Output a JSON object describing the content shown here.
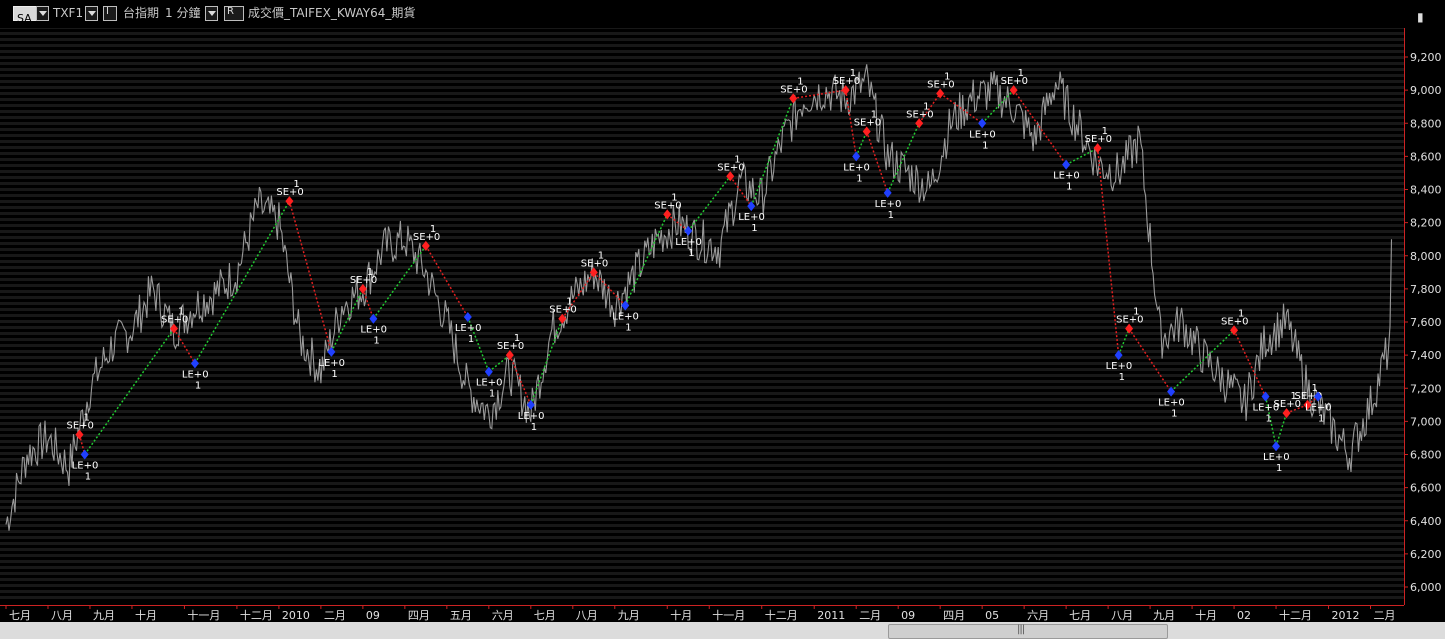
{
  "toolbar": {
    "symbol_button": "SA",
    "symbol": "TXF1",
    "mode_button": "I",
    "exchange_name": "台指期",
    "interval": "1 分鐘",
    "chart_type_button": "R",
    "series_desc": "成交價_TAIFEX_KWAY64_期貨",
    "settings_icon": "settings-icon"
  },
  "colors": {
    "background": "#000000",
    "price": "#9a9a9a",
    "trend_line": "#22c832",
    "sell_marker": "#ff2020",
    "buy_marker": "#2040ff",
    "axis_border": "#cc2222"
  },
  "chart_data": {
    "type": "line",
    "ylim": [
      5900,
      9300
    ],
    "y_ticks": [
      "9,200",
      "9,000",
      "8,800",
      "8,600",
      "8,400",
      "8,200",
      "8,000",
      "7,800",
      "7,600",
      "7,400",
      "7,200",
      "7,000",
      "6,800",
      "6,600",
      "6,400",
      "6,200",
      "6,000"
    ],
    "x_ticks": [
      "七月",
      "八月",
      "九月",
      "十月",
      "十一月",
      "十二月",
      "2010",
      "二月",
      "09",
      "四月",
      "五月",
      "六月",
      "七月",
      "八月",
      "九月",
      "十月",
      "十一月",
      "十二月",
      "2011",
      "二月",
      "09",
      "四月",
      "05",
      "六月",
      "七月",
      "八月",
      "九月",
      "十月",
      "02",
      "十二月",
      "2012",
      "二月"
    ],
    "x_tick_index": [
      0,
      4,
      8,
      12,
      17,
      22,
      26,
      30,
      34,
      38,
      42,
      46,
      50,
      54,
      58,
      63,
      67,
      72,
      77,
      81,
      85,
      89,
      93,
      97,
      101,
      105,
      109,
      113,
      117,
      121,
      126,
      130
    ],
    "price_series": {
      "name": "TXF1",
      "x": [
        0,
        2,
        4,
        6,
        8,
        10,
        12,
        14,
        16,
        18,
        20,
        22,
        24,
        26,
        28,
        30,
        32,
        34,
        36,
        38,
        40,
        42,
        44,
        46,
        48,
        50,
        52,
        54,
        56,
        58,
        60,
        62,
        64,
        66,
        68,
        70,
        72,
        74,
        76,
        78,
        80,
        82,
        84,
        86,
        88,
        90,
        92,
        94,
        96,
        98,
        100,
        102,
        104,
        106,
        108,
        110,
        112,
        114,
        116,
        118,
        120,
        122,
        124,
        126,
        128,
        130,
        132
      ],
      "close": [
        6380,
        6800,
        6900,
        6720,
        7200,
        7450,
        7560,
        7800,
        7550,
        7700,
        7780,
        7900,
        8300,
        8200,
        7500,
        7300,
        7700,
        7800,
        8050,
        8100,
        7900,
        7600,
        7200,
        7050,
        7300,
        7050,
        7550,
        7750,
        7900,
        7700,
        7900,
        8100,
        8200,
        8100,
        8050,
        8450,
        8350,
        8700,
        8950,
        9000,
        8950,
        9050,
        8600,
        8500,
        8400,
        8800,
        8950,
        9000,
        8900,
        8700,
        9050,
        8800,
        8550,
        8500,
        8700,
        7500,
        7600,
        7400,
        7250,
        7100,
        7500,
        7600,
        7200,
        7000,
        6800,
        7100,
        7500,
        8100
      ]
    },
    "trades": [
      {
        "x": 7,
        "price": 6920,
        "type": "SE"
      },
      {
        "x": 7.5,
        "price": 6800,
        "type": "LE"
      },
      {
        "x": 16,
        "price": 7560,
        "type": "SE"
      },
      {
        "x": 18,
        "price": 7350,
        "type": "LE"
      },
      {
        "x": 27,
        "price": 8330,
        "type": "SE"
      },
      {
        "x": 31,
        "price": 7420,
        "type": "LE"
      },
      {
        "x": 34,
        "price": 7800,
        "type": "SE"
      },
      {
        "x": 35,
        "price": 7620,
        "type": "LE"
      },
      {
        "x": 40,
        "price": 8060,
        "type": "SE"
      },
      {
        "x": 44,
        "price": 7630,
        "type": "LE"
      },
      {
        "x": 46,
        "price": 7300,
        "type": "LE"
      },
      {
        "x": 48,
        "price": 7400,
        "type": "SE"
      },
      {
        "x": 50,
        "price": 7100,
        "type": "LE"
      },
      {
        "x": 53,
        "price": 7620,
        "type": "SE"
      },
      {
        "x": 56,
        "price": 7900,
        "type": "SE"
      },
      {
        "x": 59,
        "price": 7700,
        "type": "LE"
      },
      {
        "x": 63,
        "price": 8250,
        "type": "SE"
      },
      {
        "x": 65,
        "price": 8150,
        "type": "LE"
      },
      {
        "x": 69,
        "price": 8480,
        "type": "SE"
      },
      {
        "x": 71,
        "price": 8300,
        "type": "LE"
      },
      {
        "x": 75,
        "price": 8950,
        "type": "SE"
      },
      {
        "x": 80,
        "price": 9000,
        "type": "SE"
      },
      {
        "x": 81,
        "price": 8600,
        "type": "LE"
      },
      {
        "x": 82,
        "price": 8750,
        "type": "SE"
      },
      {
        "x": 84,
        "price": 8380,
        "type": "LE"
      },
      {
        "x": 87,
        "price": 8800,
        "type": "SE"
      },
      {
        "x": 89,
        "price": 8980,
        "type": "SE"
      },
      {
        "x": 93,
        "price": 8800,
        "type": "LE"
      },
      {
        "x": 96,
        "price": 9000,
        "type": "SE"
      },
      {
        "x": 101,
        "price": 8550,
        "type": "LE"
      },
      {
        "x": 104,
        "price": 8650,
        "type": "SE"
      },
      {
        "x": 106,
        "price": 7400,
        "type": "LE"
      },
      {
        "x": 107,
        "price": 7560,
        "type": "SE"
      },
      {
        "x": 111,
        "price": 7180,
        "type": "LE"
      },
      {
        "x": 117,
        "price": 7550,
        "type": "SE"
      },
      {
        "x": 120,
        "price": 7150,
        "type": "LE"
      },
      {
        "x": 121,
        "price": 6850,
        "type": "LE"
      },
      {
        "x": 122,
        "price": 7050,
        "type": "SE"
      },
      {
        "x": 124,
        "price": 7100,
        "type": "SE"
      },
      {
        "x": 125,
        "price": 7150,
        "type": "LE"
      }
    ],
    "trade_labels": {
      "SE": "SE+0",
      "LE": "LE+0",
      "qty": "1"
    }
  },
  "scrollbar": {
    "grip": "|||"
  }
}
